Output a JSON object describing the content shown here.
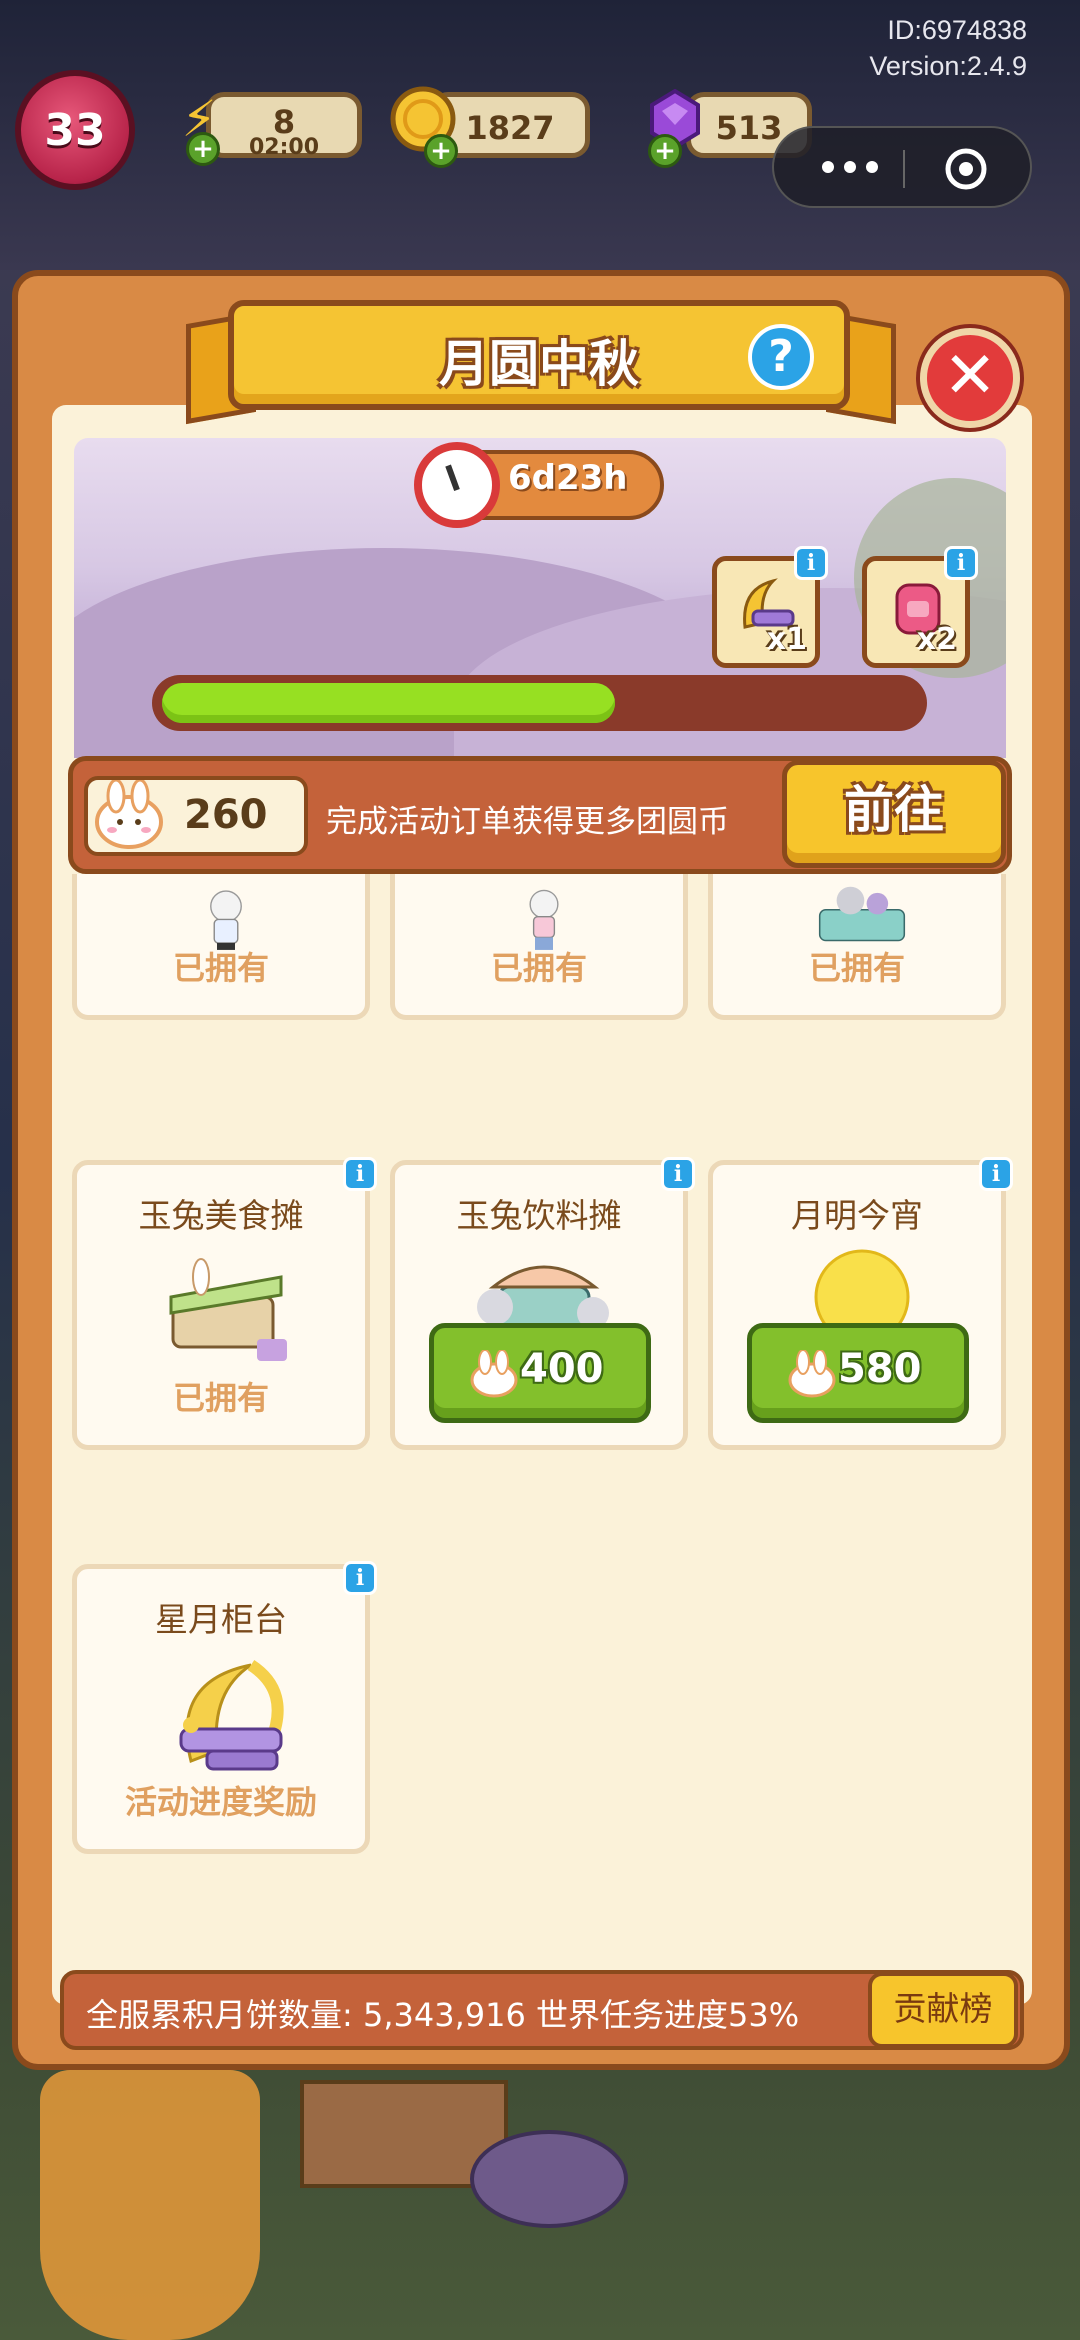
{
  "hud": {
    "id_text": "ID:6974838",
    "version_text": "Version:2.4.9",
    "level": "33",
    "energy": {
      "value": "8",
      "timer": "02:00"
    },
    "coins": "1827",
    "gems": "513"
  },
  "event": {
    "title": "月圆中秋",
    "time_left": "6d23h",
    "progress_fraction": 0.6,
    "rewards": [
      {
        "name": "star-moon-counter",
        "count": "x1"
      },
      {
        "name": "pink-backpack",
        "count": "x2"
      }
    ],
    "currency_amount": "260",
    "currency_hint": "完成活动订单获得更多团圆币",
    "go_label": "前往"
  },
  "items": [
    {
      "title": "",
      "status": "已拥有"
    },
    {
      "title": "",
      "status": "已拥有"
    },
    {
      "title": "",
      "status": "已拥有"
    },
    {
      "title": "玉兔美食摊",
      "status": "已拥有"
    },
    {
      "title": "玉兔饮料摊",
      "price": "400"
    },
    {
      "title": "月明今宵",
      "price": "580"
    },
    {
      "title": "星月柜台",
      "status": "活动进度奖励"
    }
  ],
  "footer": {
    "stat_text": "全服累积月饼数量: 5,343,916  世界任务进度53%",
    "rank_label": "贡献榜"
  },
  "colors": {
    "panel": "#d98a45",
    "panel_border": "#8a4a1c",
    "progress": "#97e022",
    "buy_button": "#83c02c",
    "go_button": "#f7c52c",
    "info": "#2ba3e6",
    "close": "#e23b3b"
  }
}
